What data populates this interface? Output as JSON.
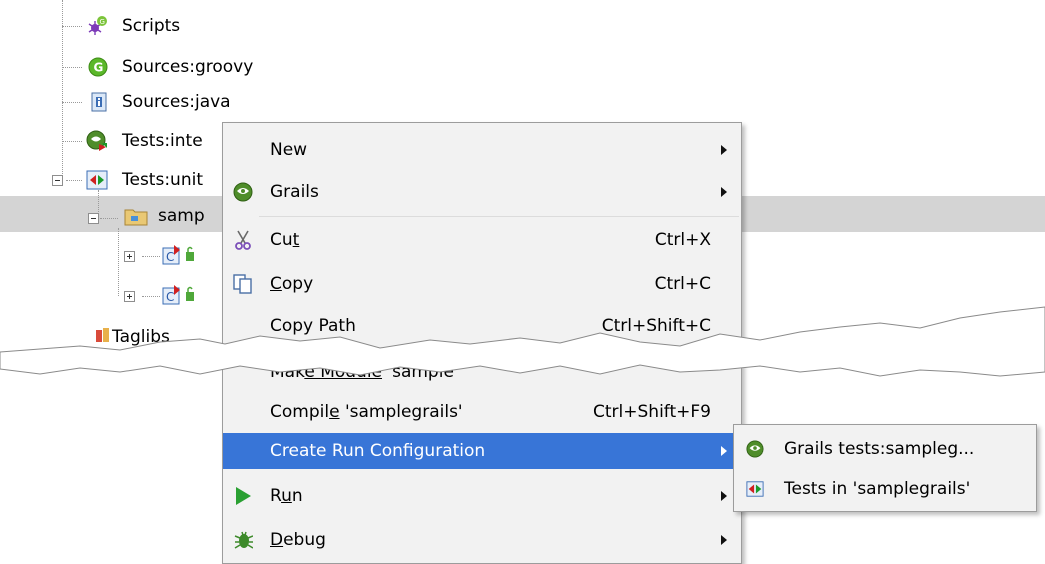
{
  "tree": {
    "items": [
      {
        "label": "Scripts",
        "icon": "scripts-icon"
      },
      {
        "label": "Sources:groovy",
        "icon": "groovy-source-icon"
      },
      {
        "label": "Sources:java",
        "icon": "java-source-icon"
      },
      {
        "label": "Tests:inte",
        "icon": "integration-tests-icon"
      },
      {
        "label": "Tests:unit",
        "icon": "unit-tests-icon"
      },
      {
        "label": "samp",
        "icon": "package-folder-icon"
      },
      {
        "label": "Taglibs",
        "icon": "taglibs-icon"
      }
    ]
  },
  "menu": {
    "new": "New",
    "grails": "Grails",
    "cut_pre": "Cu",
    "cut_key": "t",
    "cut_shortcut": "Ctrl+X",
    "copy_key": "C",
    "copy_post": "opy",
    "copy_shortcut": "Ctrl+C",
    "copy_path": "Copy Path",
    "copy_path_shortcut": "Ctrl+Shift+C",
    "module_pre": "Mak",
    "module_key": "e Module",
    "module_post": " 'sample",
    "compile_pre": "Compil",
    "compile_key": "e",
    "compile_post": " 'samplegrails'",
    "compile_shortcut": "Ctrl+Shift+F9",
    "create_run_config": "Create Run Configuration",
    "run_pre": "R",
    "run_key": "u",
    "run_post": "n",
    "debug_key": "D",
    "debug_post": "ebug"
  },
  "submenu": {
    "grails_tests": "Grails tests:sampleg...",
    "tests_in": "Tests in 'samplegrails'"
  },
  "colors": {
    "highlight": "#3875d7",
    "selection": "#d4d4d4",
    "menu_bg": "#f2f2f2"
  }
}
